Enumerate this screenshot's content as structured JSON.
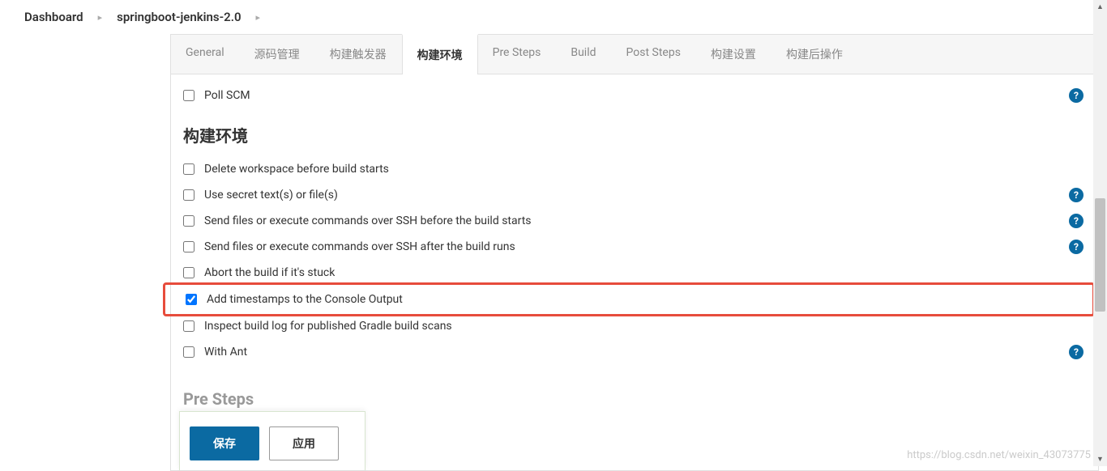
{
  "breadcrumb": {
    "items": [
      "Dashboard",
      "springboot-jenkins-2.0"
    ],
    "sep": "▸"
  },
  "tabs": [
    {
      "label": "General",
      "active": false
    },
    {
      "label": "源码管理",
      "active": false
    },
    {
      "label": "构建触发器",
      "active": false
    },
    {
      "label": "构建环境",
      "active": true
    },
    {
      "label": "Pre Steps",
      "active": false
    },
    {
      "label": "Build",
      "active": false
    },
    {
      "label": "Post Steps",
      "active": false
    },
    {
      "label": "构建设置",
      "active": false
    },
    {
      "label": "构建后操作",
      "active": false
    }
  ],
  "poll_scm": {
    "label": "Poll SCM",
    "checked": false,
    "help": true
  },
  "section_title": "构建环境",
  "build_env_options": [
    {
      "label": "Delete workspace before build starts",
      "checked": false,
      "help": false,
      "highlight": false
    },
    {
      "label": "Use secret text(s) or file(s)",
      "checked": false,
      "help": true,
      "highlight": false
    },
    {
      "label": "Send files or execute commands over SSH before the build starts",
      "checked": false,
      "help": true,
      "highlight": false
    },
    {
      "label": "Send files or execute commands over SSH after the build runs",
      "checked": false,
      "help": true,
      "highlight": false
    },
    {
      "label": "Abort the build if it's stuck",
      "checked": false,
      "help": false,
      "highlight": false
    },
    {
      "label": "Add timestamps to the Console Output",
      "checked": true,
      "help": false,
      "highlight": true
    },
    {
      "label": "Inspect build log for published Gradle build scans",
      "checked": false,
      "help": false,
      "highlight": false
    },
    {
      "label": "With Ant",
      "checked": false,
      "help": true,
      "highlight": false
    }
  ],
  "next_section_title": "Pre Steps",
  "buttons": {
    "save": "保存",
    "apply": "应用"
  },
  "help_glyph": "?",
  "watermark": "https://blog.csdn.net/weixin_43073775"
}
